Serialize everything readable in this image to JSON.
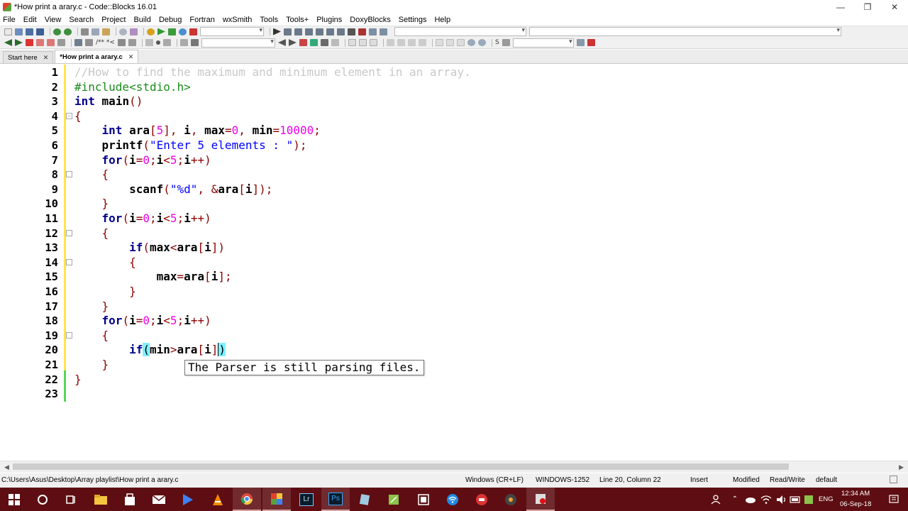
{
  "window": {
    "title": "*How print a arary.c - Code::Blocks 16.01",
    "minimize_glyph": "—",
    "maximize_glyph": "❐",
    "close_glyph": "✕"
  },
  "menu": [
    "File",
    "Edit",
    "View",
    "Search",
    "Project",
    "Build",
    "Debug",
    "Fortran",
    "wxSmith",
    "Tools",
    "Tools+",
    "Plugins",
    "DoxyBlocks",
    "Settings",
    "Help"
  ],
  "toolbar2": {
    "comment_btn": "/** *<",
    "s_btn": "S"
  },
  "tabs": [
    {
      "label": "Start here",
      "active": false
    },
    {
      "label": "*How print a arary.c",
      "active": true
    }
  ],
  "editor": {
    "line_numbers": [
      "1",
      "2",
      "3",
      "4",
      "5",
      "6",
      "7",
      "8",
      "9",
      "10",
      "11",
      "12",
      "13",
      "14",
      "15",
      "16",
      "17",
      "18",
      "19",
      "20",
      "21",
      "22",
      "23"
    ],
    "code": {
      "l1": "//How to find the maximum and minimum element in an array.",
      "l2": "#include<stdio.h>",
      "kw_int": "int",
      "kw_for": "for",
      "kw_if": "if",
      "main": "main",
      "ara": "ara",
      "i": "i",
      "max": "max",
      "min": "min",
      "printf": "printf",
      "scanf": "scanf",
      "str_enter": "\"Enter 5 elements : \"",
      "str_fmt": "\"%d\"",
      "n0": "0",
      "n5": "5",
      "n10000": "10000"
    },
    "tooltip": "The Parser is still parsing files."
  },
  "statusbar": {
    "path": "C:\\Users\\Asus\\Desktop\\Array playlist\\How print a arary.c",
    "eol": "Windows (CR+LF)",
    "encoding": "WINDOWS-1252",
    "position": "Line 20, Column 22",
    "mode": "Insert",
    "modified": "Modified",
    "access": "Read/Write",
    "profile": "default"
  },
  "taskbar": {
    "lang": "ENG",
    "time": "12:34 AM",
    "date": "06-Sep-18",
    "lr_label": "Lr",
    "ps_label": "Ps",
    "accent": "#5e0e12"
  }
}
